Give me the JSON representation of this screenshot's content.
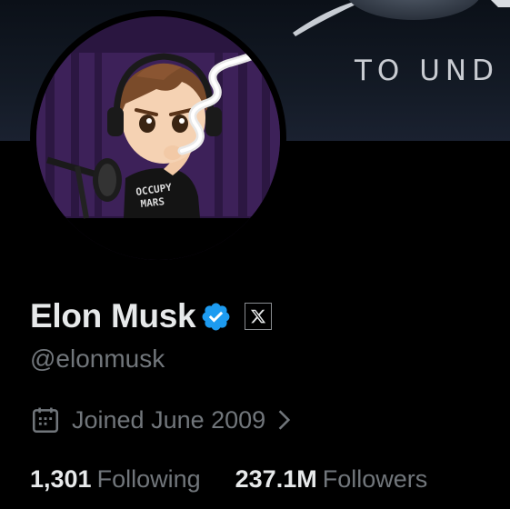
{
  "banner": {
    "text": "TO UND"
  },
  "avatar": {
    "shirt_line1": "OCCUPY",
    "shirt_line2": "MARS"
  },
  "profile": {
    "display_name": "Elon Musk",
    "handle": "@elonmusk",
    "verified_color": "#1d9bf0",
    "affiliate_icon": "x-logo-icon",
    "joined": "Joined June 2009"
  },
  "stats": {
    "following_count": "1,301",
    "following_label": "Following",
    "followers_count": "237.1M",
    "followers_label": "Followers"
  }
}
